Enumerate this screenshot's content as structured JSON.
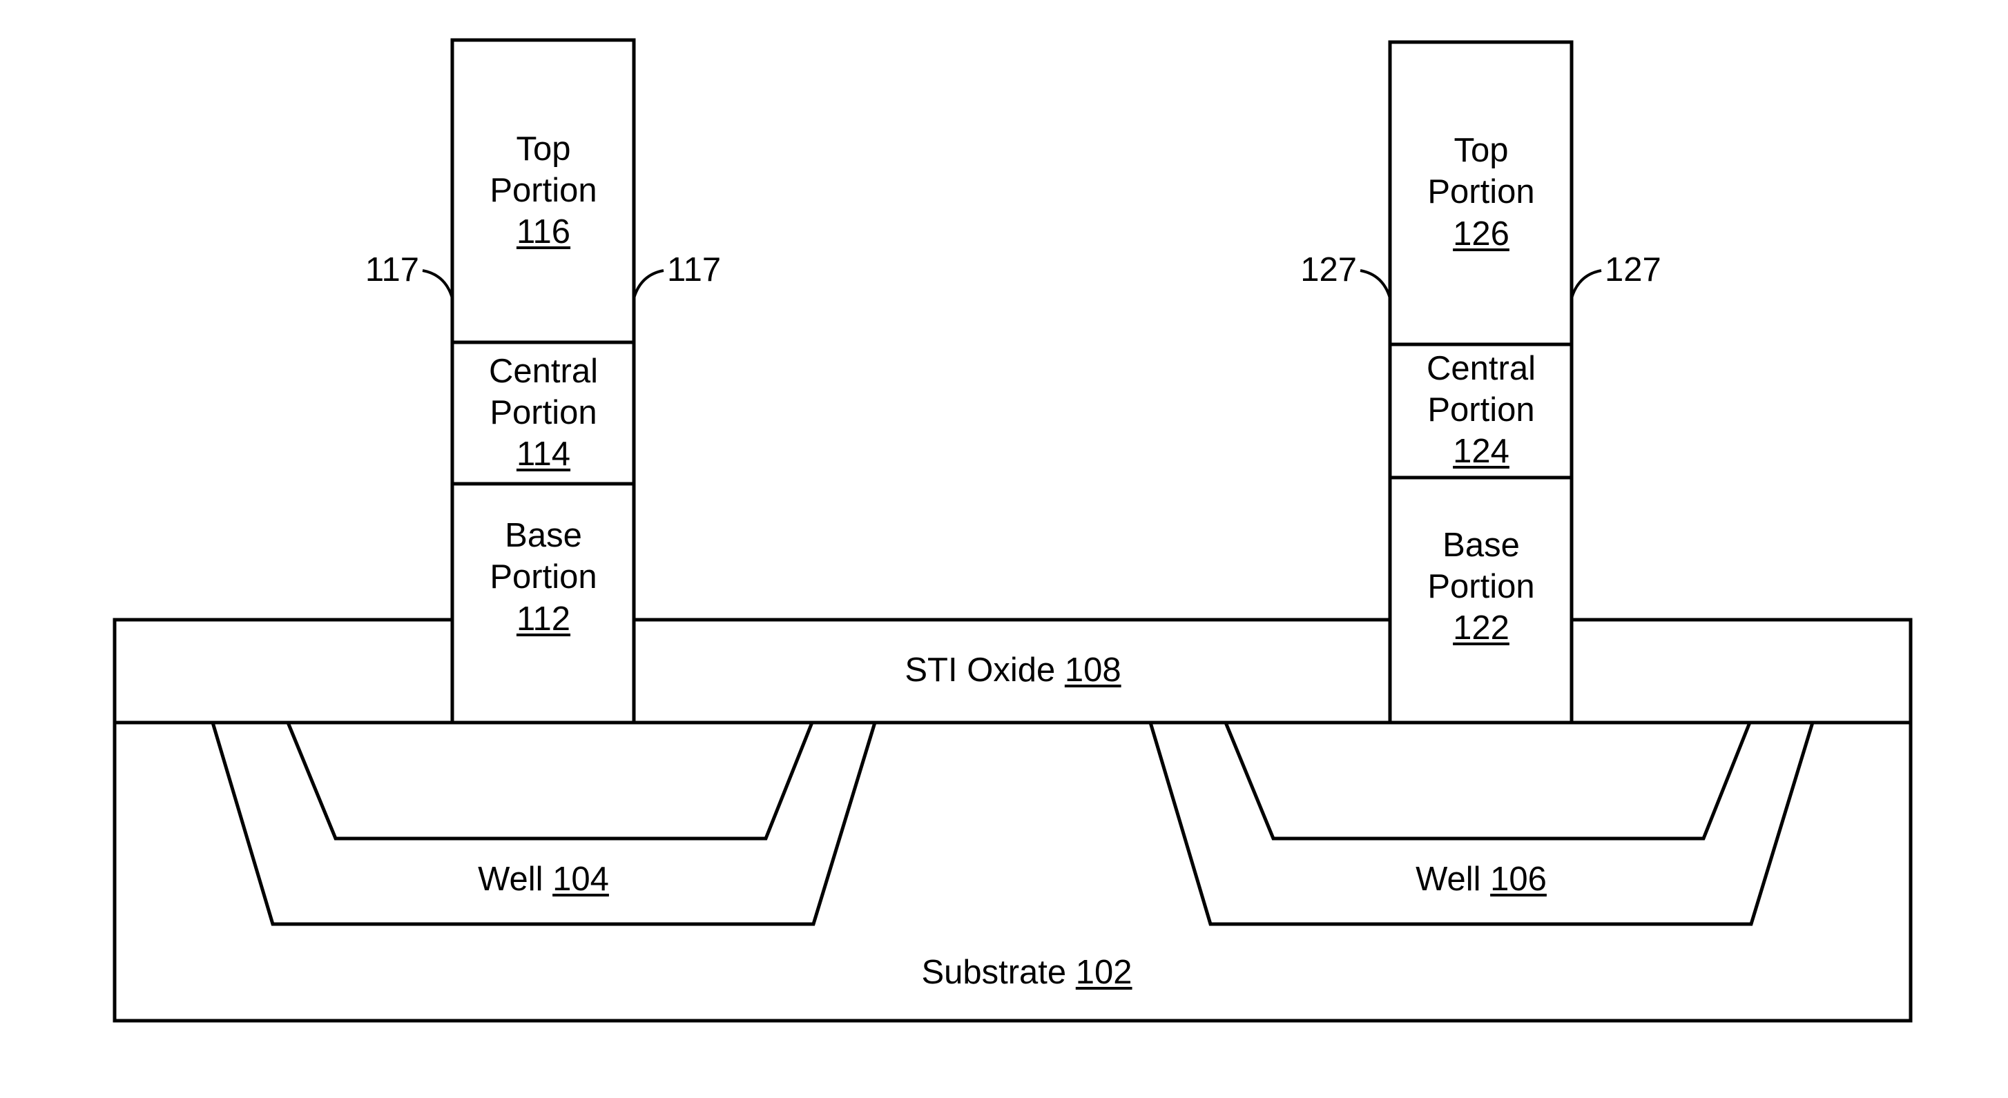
{
  "figure": {
    "colors": {
      "line": "#000000",
      "background": "#ffffff"
    },
    "regions": {
      "substrate": {
        "name": "Substrate",
        "ref": "102"
      },
      "well_left": {
        "name": "Well",
        "ref": "104"
      },
      "well_right": {
        "name": "Well",
        "ref": "106"
      },
      "sti_oxide": {
        "name": "STI Oxide",
        "ref": "108"
      }
    },
    "fin_left": {
      "base": {
        "line1": "Base",
        "line2": "Portion",
        "ref": "112"
      },
      "central": {
        "line1": "Central",
        "line2": "Portion",
        "ref": "114"
      },
      "top": {
        "line1": "Top",
        "line2": "Portion",
        "ref": "116"
      },
      "sidewall_callout_left": "117",
      "sidewall_callout_right": "117"
    },
    "fin_right": {
      "base": {
        "line1": "Base",
        "line2": "Portion",
        "ref": "122"
      },
      "central": {
        "line1": "Central",
        "line2": "Portion",
        "ref": "124"
      },
      "top": {
        "line1": "Top",
        "line2": "Portion",
        "ref": "126"
      },
      "sidewall_callout_left": "127",
      "sidewall_callout_right": "127"
    }
  }
}
